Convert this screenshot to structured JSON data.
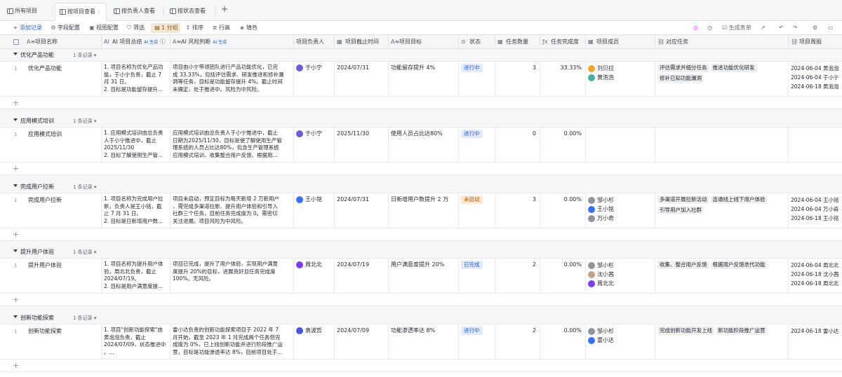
{
  "tabs": [
    {
      "label": "所有项目",
      "icon": "grid-icon"
    },
    {
      "label": "按项目查看",
      "icon": "grid-icon",
      "active": true
    },
    {
      "label": "按负责人查看",
      "icon": "kanban-icon"
    },
    {
      "label": "按状态查看",
      "icon": "grid-icon"
    }
  ],
  "toolbar": {
    "add_record": "添加记录",
    "field_config": "字段配置",
    "view_config": "视图配置",
    "filter": "筛选",
    "group": "1 分组",
    "sort": "排序",
    "row_height": "行高",
    "fill_color": "填色",
    "generate_form": "生成表单"
  },
  "columns": {
    "name": "项目名称",
    "summary": "AI 项目总结",
    "risk": "AI 风险判断",
    "owner": "项目负责人",
    "deadline": "项目截止时间",
    "goal": "项目目标",
    "status": "状态",
    "task_count": "任务数量",
    "completion": "任务完成度",
    "members": "项目成员",
    "tasks": "对应任务",
    "weekly": "项目周报",
    "ai_tag": "AI 生成"
  },
  "add_row_symbol": "+",
  "groups": [
    {
      "title": "优化产品功能",
      "count": "1 条记录",
      "row": {
        "num": "1",
        "name": "优化产品功能",
        "summary": "1. 项目名称为优化产品功\n能，于小宁负责，截止 7\n月 31 日。\n2. 目标是功能留存提升...",
        "risk": "项目由小宁带领团队进行产品功能优化，已完\n成 33.33%，包括评估需求、研发推进和修补漏\n洞等任务，目标是功能留存提升 4%。截止时间\n未确定，处于推进中。风险为中风险。",
        "owner": "于小宁",
        "owner_color": "#6a5bd6",
        "deadline": "2024/07/31",
        "goal": "功能留存提升 4%",
        "status": "进行中",
        "status_bg": "#e1eaff",
        "status_fg": "#245bdb",
        "task_count": "3",
        "completion": "33.33%",
        "members": [
          {
            "name": "刘贝拉",
            "color": "#f5a623"
          },
          {
            "name": "黄泡泡",
            "color": "#3eb2a8"
          }
        ],
        "tasks": [
          "评估需求并细分任务",
          "推进功能优化研发",
          "修补已知功能漏洞"
        ],
        "weekly": [
          "2024-06-04 黄泡泡",
          "2024-06-04 于小宁",
          "2024-06-18 黄泡泡"
        ]
      }
    },
    {
      "title": "应用模式培训",
      "count": "1 条记录",
      "row": {
        "num": "1",
        "name": "应用模式培训",
        "summary": "1. 应用模式培训由总负责\n人于小宁推进中，截止\n2025/11/30\n2. 目标了解使用生产管...",
        "risk": "应用模式培训由总负责人于小宁推进中，截止\n日期为2025/11/30，目标是使了解使用生产管\n理系统的人员占比达80%，包含生产管理系统\n应用模式培训、收集整合用户反馈、根据用...",
        "owner": "于小宁",
        "owner_color": "#6a5bd6",
        "deadline": "2025/11/30",
        "goal": "使用人员占比达80%",
        "status": "进行中",
        "status_bg": "#e1eaff",
        "status_fg": "#245bdb",
        "task_count": "0",
        "completion": "0.00%",
        "members": [],
        "tasks": [],
        "weekly": []
      }
    },
    {
      "title": "完成用户拉新",
      "count": "1 条记录",
      "row": {
        "num": "1",
        "name": "完成用户拉新",
        "summary": "1. 项目名称为完成用户拉\n新，负责人是王小铭，截\n止 7 月 31 日。\n2. 目标是日新增用户数...",
        "risk": "项目未启动，预定目标为每天新增 2 万新用户\n，需完成多渠道拉新、提升用户体验和引导入\n社群三个任务，目前任务完成度为 0。需密切\n关注进展。项目风险为中风险。",
        "owner": "王小铭",
        "owner_color": "#3370ff",
        "deadline": "2024/07/31",
        "goal": "日新增用户数提升 2 万",
        "status": "未启动",
        "status_bg": "#fde7d2",
        "status_fg": "#b35e00",
        "task_count": "3",
        "completion": "0.00%",
        "members": [
          {
            "name": "邹小杉",
            "color": "#8f959e"
          },
          {
            "name": "王小铭",
            "color": "#3370ff"
          },
          {
            "name": "万小奇",
            "color": "#8f959e"
          }
        ],
        "tasks": [
          "多渠道开展拉新活动",
          "连通线上线下用户体验",
          "引导用户加入社群"
        ],
        "weekly": [
          "2024-06-04 王小铭",
          "2024-06-04 万小奇",
          "2024-06-18 王小铭"
        ]
      }
    },
    {
      "title": "提升用户体验",
      "count": "1 条记录",
      "row": {
        "num": "1",
        "name": "提升用户体验",
        "summary": "1. 项目名称为提升用户体\n验，周北北负责，截止\n2024/07/19。\n2. 目标是用户满意度提...",
        "risk": "项目已完成，提升了用户体验，实现用户满意\n度提升 20%的目标，进展良好且任务完成度\n100%。无风险。",
        "owner": "周北北",
        "owner_color": "#7f3bf5",
        "deadline": "2024/07/19",
        "goal": "用户满意度提升 20%",
        "status": "已完成",
        "status_bg": "#e1eaff",
        "status_fg": "#245bdb",
        "task_count": "2",
        "completion": "0.00%",
        "members": [
          {
            "name": "邹小杉",
            "color": "#8f959e"
          },
          {
            "name": "沈小茜",
            "color": "#c4a484"
          },
          {
            "name": "周北北",
            "color": "#7f3bf5"
          }
        ],
        "tasks": [
          "收集、整合用户反馈",
          "根据用户反馈迭代功能"
        ],
        "weekly": [
          "2024-06-04 周北北",
          "2024-06-18 沈小茜",
          "2024-06-18 周北北"
        ]
      }
    },
    {
      "title": "创新功能探索",
      "count": "1 条记录",
      "row": {
        "num": "1",
        "name": "创新功能探索",
        "summary": "1. 项目\"创新功能探索\"由\n黄泡泡负责，截止\n2024/07/09，状态推进中\n。...",
        "risk": "雷小达负责的创新功能探索项目于 2022 年 7\n月开始，截至 2023 年 1 月完成两个任务但完\n成度为 0%，已上线创新功能并进行阶段推广运\n营，目标是功能渗透率达 8%，目前项目处于...",
        "owner": "袁波哲",
        "owner_color": "#4954e6",
        "deadline": "2024/07/09",
        "goal": "功能渗透率达 8%",
        "status": "进行中",
        "status_bg": "#e1eaff",
        "status_fg": "#245bdb",
        "task_count": "2",
        "completion": "0.00%",
        "members": [
          {
            "name": "邹小杉",
            "color": "#8f959e"
          },
          {
            "name": "雷小达",
            "color": "#3370ff"
          }
        ],
        "tasks": [
          "完成创新功能开发上线",
          "新功能阶段推广运营"
        ],
        "weekly": [
          "2024-06-18 雷小达"
        ]
      }
    }
  ]
}
